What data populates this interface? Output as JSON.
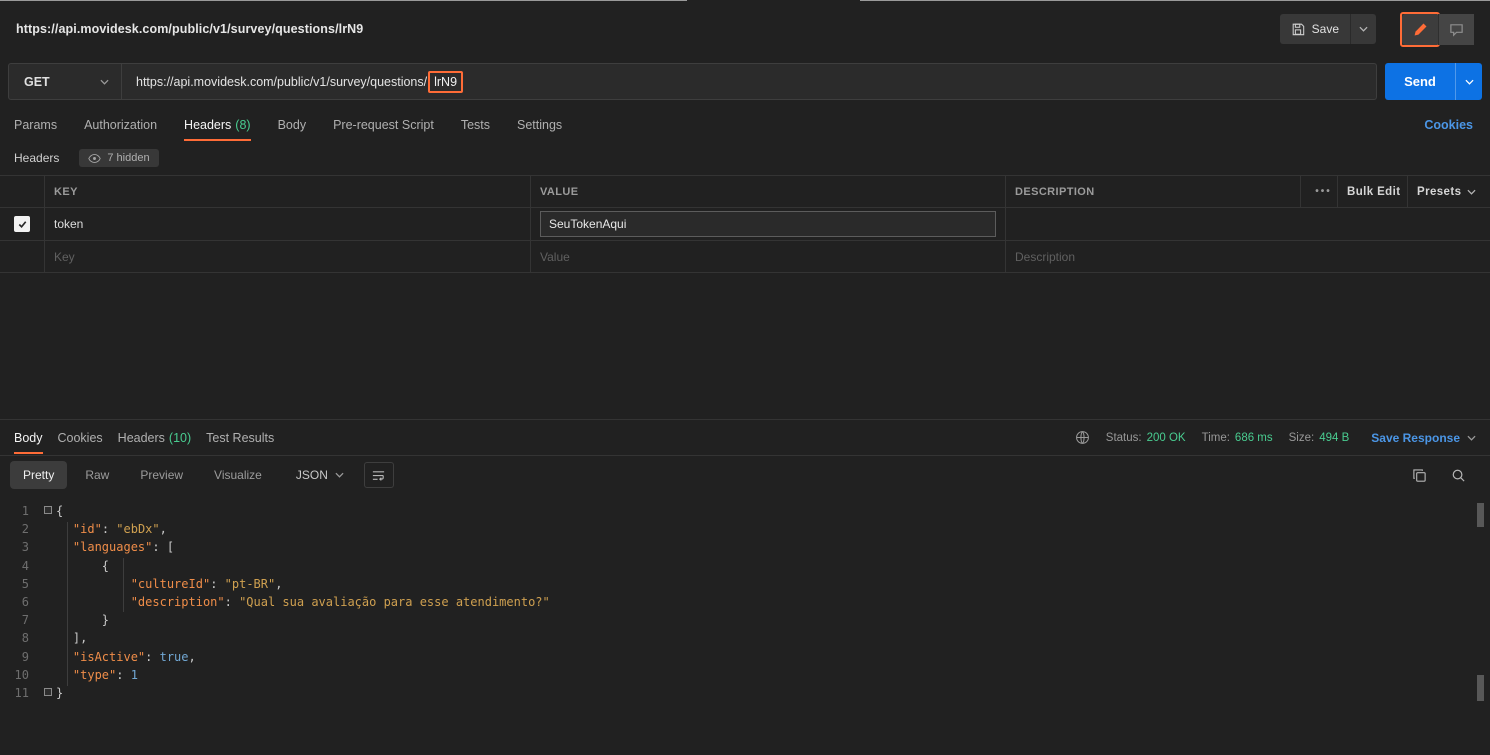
{
  "topbar": {
    "title": "https://api.movidesk.com/public/v1/survey/questions/lrN9",
    "save": "Save"
  },
  "request": {
    "method": "GET",
    "url_prefix": "https://api.movidesk.com/public/v1/survey/questions/",
    "url_highlight": "lrN9",
    "send": "Send"
  },
  "request_tabs": {
    "params": "Params",
    "authorization": "Authorization",
    "headers": "Headers",
    "headers_count": "(8)",
    "body": "Body",
    "prerequest": "Pre-request Script",
    "tests": "Tests",
    "settings": "Settings",
    "cookies": "Cookies"
  },
  "headers_panel": {
    "title": "Headers",
    "hidden": "7 hidden",
    "col_key": "KEY",
    "col_value": "VALUE",
    "col_description": "DESCRIPTION",
    "bulk_edit": "Bulk Edit",
    "presets": "Presets",
    "row1": {
      "key": "token",
      "value": "SeuTokenAqui"
    },
    "placeholder": {
      "key": "Key",
      "value": "Value",
      "description": "Description"
    }
  },
  "response": {
    "tab_body": "Body",
    "tab_cookies": "Cookies",
    "tab_headers": "Headers",
    "tab_headers_count": "(10)",
    "tab_tests": "Test Results",
    "status_label": "Status:",
    "status_value": "200 OK",
    "time_label": "Time:",
    "time_value": "686 ms",
    "size_label": "Size:",
    "size_value": "494 B",
    "save_response": "Save Response",
    "view_pretty": "Pretty",
    "view_raw": "Raw",
    "view_preview": "Preview",
    "view_visualize": "Visualize",
    "format": "JSON",
    "code": [
      {
        "n": 1,
        "fold": true,
        "tokens": [
          [
            "p",
            "{"
          ]
        ]
      },
      {
        "n": 2,
        "tokens": [
          [
            "w",
            "    "
          ],
          [
            "k",
            "\"id\""
          ],
          [
            "p",
            ": "
          ],
          [
            "s",
            "\"ebDx\""
          ],
          [
            "p",
            ","
          ]
        ]
      },
      {
        "n": 3,
        "tokens": [
          [
            "w",
            "    "
          ],
          [
            "k",
            "\"languages\""
          ],
          [
            "p",
            ": ["
          ]
        ]
      },
      {
        "n": 4,
        "tokens": [
          [
            "w",
            "        "
          ],
          [
            "p",
            "{"
          ]
        ]
      },
      {
        "n": 5,
        "tokens": [
          [
            "w",
            "            "
          ],
          [
            "k",
            "\"cultureId\""
          ],
          [
            "p",
            ": "
          ],
          [
            "s",
            "\"pt-BR\""
          ],
          [
            "p",
            ","
          ]
        ]
      },
      {
        "n": 6,
        "tokens": [
          [
            "w",
            "            "
          ],
          [
            "k",
            "\"description\""
          ],
          [
            "p",
            ": "
          ],
          [
            "s",
            "\"Qual sua avaliação para esse atendimento?\""
          ]
        ]
      },
      {
        "n": 7,
        "tokens": [
          [
            "w",
            "        "
          ],
          [
            "p",
            "}"
          ]
        ]
      },
      {
        "n": 8,
        "tokens": [
          [
            "w",
            "    "
          ],
          [
            "p",
            "],"
          ]
        ]
      },
      {
        "n": 9,
        "tokens": [
          [
            "w",
            "    "
          ],
          [
            "k",
            "\"isActive\""
          ],
          [
            "p",
            ": "
          ],
          [
            "l",
            "true"
          ],
          [
            "p",
            ","
          ]
        ]
      },
      {
        "n": 10,
        "tokens": [
          [
            "w",
            "    "
          ],
          [
            "k",
            "\"type\""
          ],
          [
            "p",
            ": "
          ],
          [
            "l",
            "1"
          ]
        ]
      },
      {
        "n": 11,
        "fold": true,
        "tokens": [
          [
            "p",
            "}"
          ]
        ]
      }
    ]
  },
  "colors": {
    "accent_orange": "#ff6c37",
    "accent_blue": "#0d72e4",
    "success_green": "#49cc90",
    "link_blue": "#4b96e6",
    "json_key": "#ef8d49",
    "json_string": "#cfa050",
    "json_literal": "#71a7d3"
  }
}
